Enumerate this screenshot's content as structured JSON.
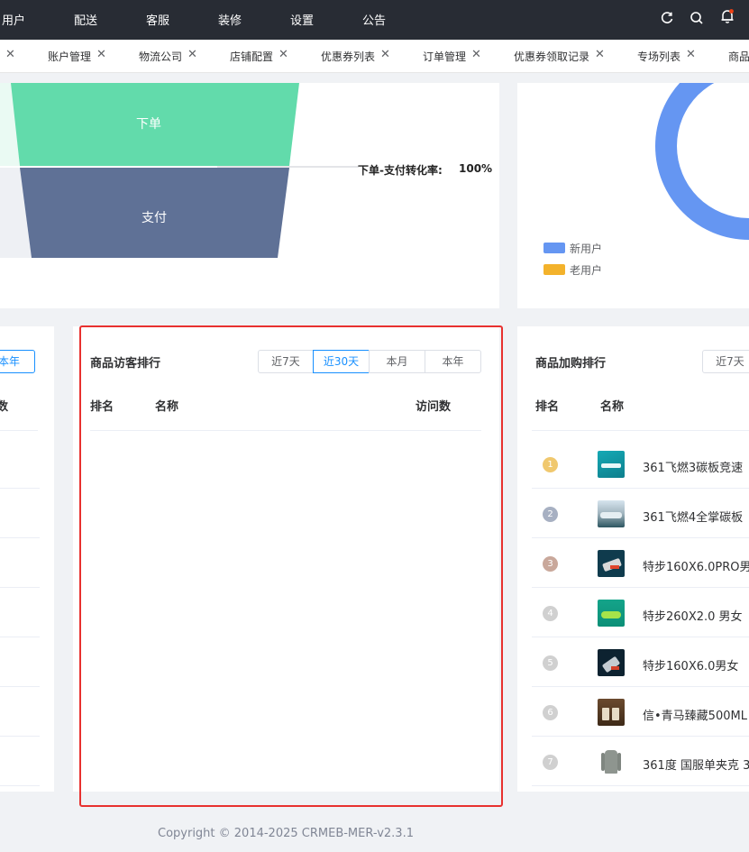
{
  "top_nav": {
    "items": [
      "用户",
      "配送",
      "客服",
      "装修",
      "设置",
      "公告"
    ]
  },
  "top_icons": [
    "refresh-icon",
    "search-icon",
    "notification-bell-icon"
  ],
  "tabs": [
    {
      "label": "账户管理"
    },
    {
      "label": "物流公司"
    },
    {
      "label": "店铺配置"
    },
    {
      "label": "优惠券列表"
    },
    {
      "label": "订单管理"
    },
    {
      "label": "优惠券领取记录"
    },
    {
      "label": "专场列表"
    },
    {
      "label": "商品"
    }
  ],
  "funnel": {
    "stage_order": "下单",
    "stage_pay": "支付",
    "conversion_label": "下单-支付转化率:",
    "conversion_value": "100%",
    "colors": {
      "order": "#62dbab",
      "pay": "#5f7196",
      "order_ghost": "#eafaf3",
      "pay_ghost": "#eef0f4"
    }
  },
  "user_donut": {
    "legend": [
      {
        "label": "新用户",
        "color": "#6596f2"
      },
      {
        "label": "老用户",
        "color": "#f3b22b"
      }
    ]
  },
  "left_card": {
    "partial_button": "本年",
    "partial_header": "数"
  },
  "visitor_ranking": {
    "title": "商品访客排行",
    "periods": [
      "近7天",
      "近30天",
      "本月",
      "本年"
    ],
    "active_period": "近30天",
    "columns": {
      "rank": "排名",
      "name": "名称",
      "visits": "访问数"
    },
    "rows": []
  },
  "cart_ranking": {
    "title": "商品加购排行",
    "periods": [
      "近7天"
    ],
    "columns": {
      "rank": "排名",
      "name": "名称"
    },
    "rows": [
      {
        "rank": "1",
        "name": "361飞燃3碳板竞速",
        "rank_color": "#f0c86e"
      },
      {
        "rank": "2",
        "name": "361飞燃4全掌碳板",
        "rank_color": "#a7b0c2"
      },
      {
        "rank": "3",
        "name": "特步160X6.0PRO男",
        "rank_color": "#c9a89b"
      },
      {
        "rank": "4",
        "name": "特步260X2.0 男女",
        "rank_color": "#d0d0d0"
      },
      {
        "rank": "5",
        "name": "特步160X6.0男女",
        "rank_color": "#d0d0d0"
      },
      {
        "rank": "6",
        "name": "信•青马臻藏500ML",
        "rank_color": "#d0d0d0"
      },
      {
        "rank": "7",
        "name": "361度 国服单夹克 3",
        "rank_color": "#d0d0d0"
      }
    ]
  },
  "footer": {
    "copyright": "Copyright © 2014-2025 CRMEB-MER-v2.3.1"
  }
}
